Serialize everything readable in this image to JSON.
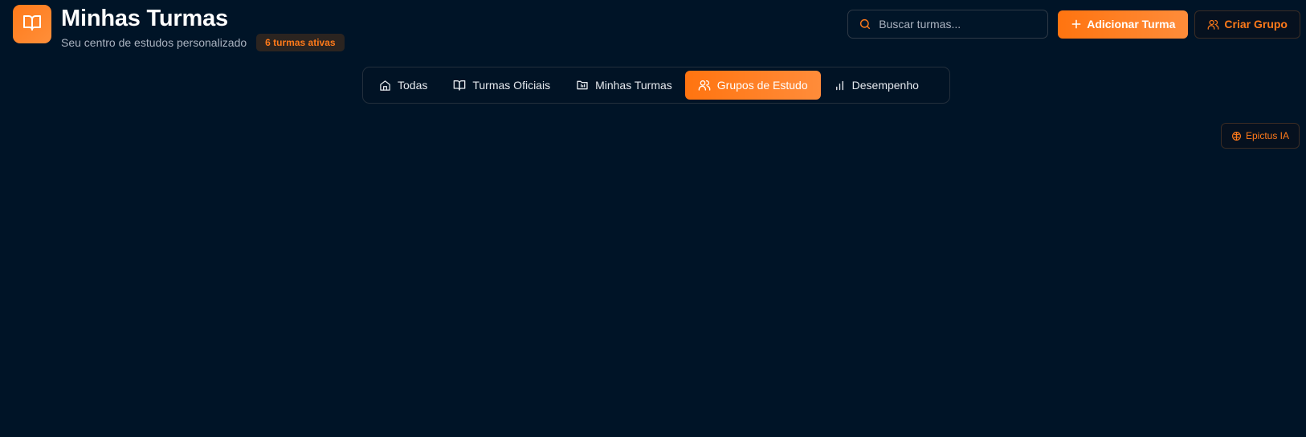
{
  "header": {
    "title": "Minhas Turmas",
    "subtitle": "Seu centro de estudos personalizado",
    "badge": "6 turmas ativas",
    "logo_icon": "book-open-icon"
  },
  "search": {
    "placeholder": "Buscar turmas...",
    "value": ""
  },
  "actions": {
    "add_class_label": "Adicionar Turma",
    "create_group_label": "Criar Grupo"
  },
  "tabs": [
    {
      "label": "Todas",
      "icon": "home-icon",
      "active": false
    },
    {
      "label": "Turmas Oficiais",
      "icon": "book-open-icon",
      "active": false
    },
    {
      "label": "Minhas Turmas",
      "icon": "folder-icon",
      "active": false
    },
    {
      "label": "Grupos de Estudo",
      "icon": "users-icon",
      "active": true
    },
    {
      "label": "Desempenho",
      "icon": "bar-chart-icon",
      "active": false
    }
  ],
  "ai_button": {
    "label": "Epictus IA",
    "icon": "brain-icon"
  },
  "colors": {
    "background": "#001427",
    "accent": "#ff7a1a",
    "text_muted": "#aab3c0"
  }
}
